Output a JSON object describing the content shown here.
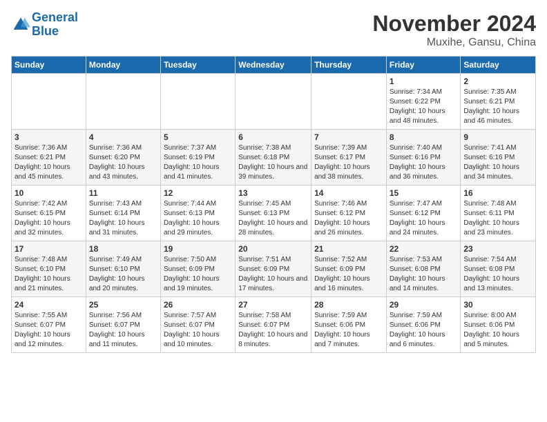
{
  "header": {
    "logo_line1": "General",
    "logo_line2": "Blue",
    "month_title": "November 2024",
    "location": "Muxihe, Gansu, China"
  },
  "weekdays": [
    "Sunday",
    "Monday",
    "Tuesday",
    "Wednesday",
    "Thursday",
    "Friday",
    "Saturday"
  ],
  "weeks": [
    [
      {
        "day": "",
        "info": ""
      },
      {
        "day": "",
        "info": ""
      },
      {
        "day": "",
        "info": ""
      },
      {
        "day": "",
        "info": ""
      },
      {
        "day": "",
        "info": ""
      },
      {
        "day": "1",
        "info": "Sunrise: 7:34 AM\nSunset: 6:22 PM\nDaylight: 10 hours and 48 minutes."
      },
      {
        "day": "2",
        "info": "Sunrise: 7:35 AM\nSunset: 6:21 PM\nDaylight: 10 hours and 46 minutes."
      }
    ],
    [
      {
        "day": "3",
        "info": "Sunrise: 7:36 AM\nSunset: 6:21 PM\nDaylight: 10 hours and 45 minutes."
      },
      {
        "day": "4",
        "info": "Sunrise: 7:36 AM\nSunset: 6:20 PM\nDaylight: 10 hours and 43 minutes."
      },
      {
        "day": "5",
        "info": "Sunrise: 7:37 AM\nSunset: 6:19 PM\nDaylight: 10 hours and 41 minutes."
      },
      {
        "day": "6",
        "info": "Sunrise: 7:38 AM\nSunset: 6:18 PM\nDaylight: 10 hours and 39 minutes."
      },
      {
        "day": "7",
        "info": "Sunrise: 7:39 AM\nSunset: 6:17 PM\nDaylight: 10 hours and 38 minutes."
      },
      {
        "day": "8",
        "info": "Sunrise: 7:40 AM\nSunset: 6:16 PM\nDaylight: 10 hours and 36 minutes."
      },
      {
        "day": "9",
        "info": "Sunrise: 7:41 AM\nSunset: 6:16 PM\nDaylight: 10 hours and 34 minutes."
      }
    ],
    [
      {
        "day": "10",
        "info": "Sunrise: 7:42 AM\nSunset: 6:15 PM\nDaylight: 10 hours and 32 minutes."
      },
      {
        "day": "11",
        "info": "Sunrise: 7:43 AM\nSunset: 6:14 PM\nDaylight: 10 hours and 31 minutes."
      },
      {
        "day": "12",
        "info": "Sunrise: 7:44 AM\nSunset: 6:13 PM\nDaylight: 10 hours and 29 minutes."
      },
      {
        "day": "13",
        "info": "Sunrise: 7:45 AM\nSunset: 6:13 PM\nDaylight: 10 hours and 28 minutes."
      },
      {
        "day": "14",
        "info": "Sunrise: 7:46 AM\nSunset: 6:12 PM\nDaylight: 10 hours and 26 minutes."
      },
      {
        "day": "15",
        "info": "Sunrise: 7:47 AM\nSunset: 6:12 PM\nDaylight: 10 hours and 24 minutes."
      },
      {
        "day": "16",
        "info": "Sunrise: 7:48 AM\nSunset: 6:11 PM\nDaylight: 10 hours and 23 minutes."
      }
    ],
    [
      {
        "day": "17",
        "info": "Sunrise: 7:48 AM\nSunset: 6:10 PM\nDaylight: 10 hours and 21 minutes."
      },
      {
        "day": "18",
        "info": "Sunrise: 7:49 AM\nSunset: 6:10 PM\nDaylight: 10 hours and 20 minutes."
      },
      {
        "day": "19",
        "info": "Sunrise: 7:50 AM\nSunset: 6:09 PM\nDaylight: 10 hours and 19 minutes."
      },
      {
        "day": "20",
        "info": "Sunrise: 7:51 AM\nSunset: 6:09 PM\nDaylight: 10 hours and 17 minutes."
      },
      {
        "day": "21",
        "info": "Sunrise: 7:52 AM\nSunset: 6:09 PM\nDaylight: 10 hours and 16 minutes."
      },
      {
        "day": "22",
        "info": "Sunrise: 7:53 AM\nSunset: 6:08 PM\nDaylight: 10 hours and 14 minutes."
      },
      {
        "day": "23",
        "info": "Sunrise: 7:54 AM\nSunset: 6:08 PM\nDaylight: 10 hours and 13 minutes."
      }
    ],
    [
      {
        "day": "24",
        "info": "Sunrise: 7:55 AM\nSunset: 6:07 PM\nDaylight: 10 hours and 12 minutes."
      },
      {
        "day": "25",
        "info": "Sunrise: 7:56 AM\nSunset: 6:07 PM\nDaylight: 10 hours and 11 minutes."
      },
      {
        "day": "26",
        "info": "Sunrise: 7:57 AM\nSunset: 6:07 PM\nDaylight: 10 hours and 10 minutes."
      },
      {
        "day": "27",
        "info": "Sunrise: 7:58 AM\nSunset: 6:07 PM\nDaylight: 10 hours and 8 minutes."
      },
      {
        "day": "28",
        "info": "Sunrise: 7:59 AM\nSunset: 6:06 PM\nDaylight: 10 hours and 7 minutes."
      },
      {
        "day": "29",
        "info": "Sunrise: 7:59 AM\nSunset: 6:06 PM\nDaylight: 10 hours and 6 minutes."
      },
      {
        "day": "30",
        "info": "Sunrise: 8:00 AM\nSunset: 6:06 PM\nDaylight: 10 hours and 5 minutes."
      }
    ]
  ]
}
